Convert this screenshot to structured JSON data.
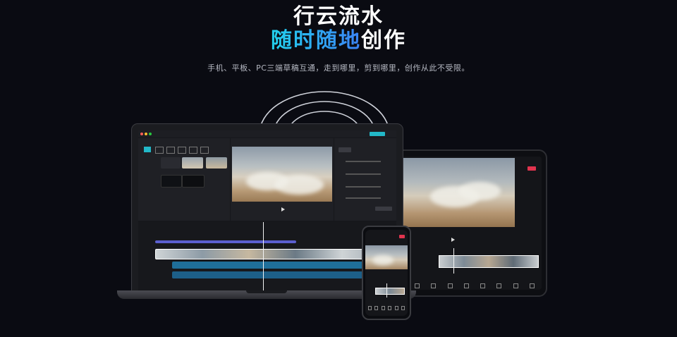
{
  "hero": {
    "title_line1": "行云流水",
    "title_line2_highlight": "随时随地",
    "title_line2_rest": "创作",
    "subtitle": "手机、平板、PC三端草稿互通，走到哪里，剪到哪里，创作从此不受限。"
  },
  "colors": {
    "background": "#0a0b12",
    "accent_gradient_start": "#22d3ee",
    "accent_gradient_end": "#3b82f6",
    "export_button": "#22b8c8",
    "badge_red": "#e0344e"
  },
  "devices": [
    "laptop",
    "tablet",
    "phone"
  ]
}
